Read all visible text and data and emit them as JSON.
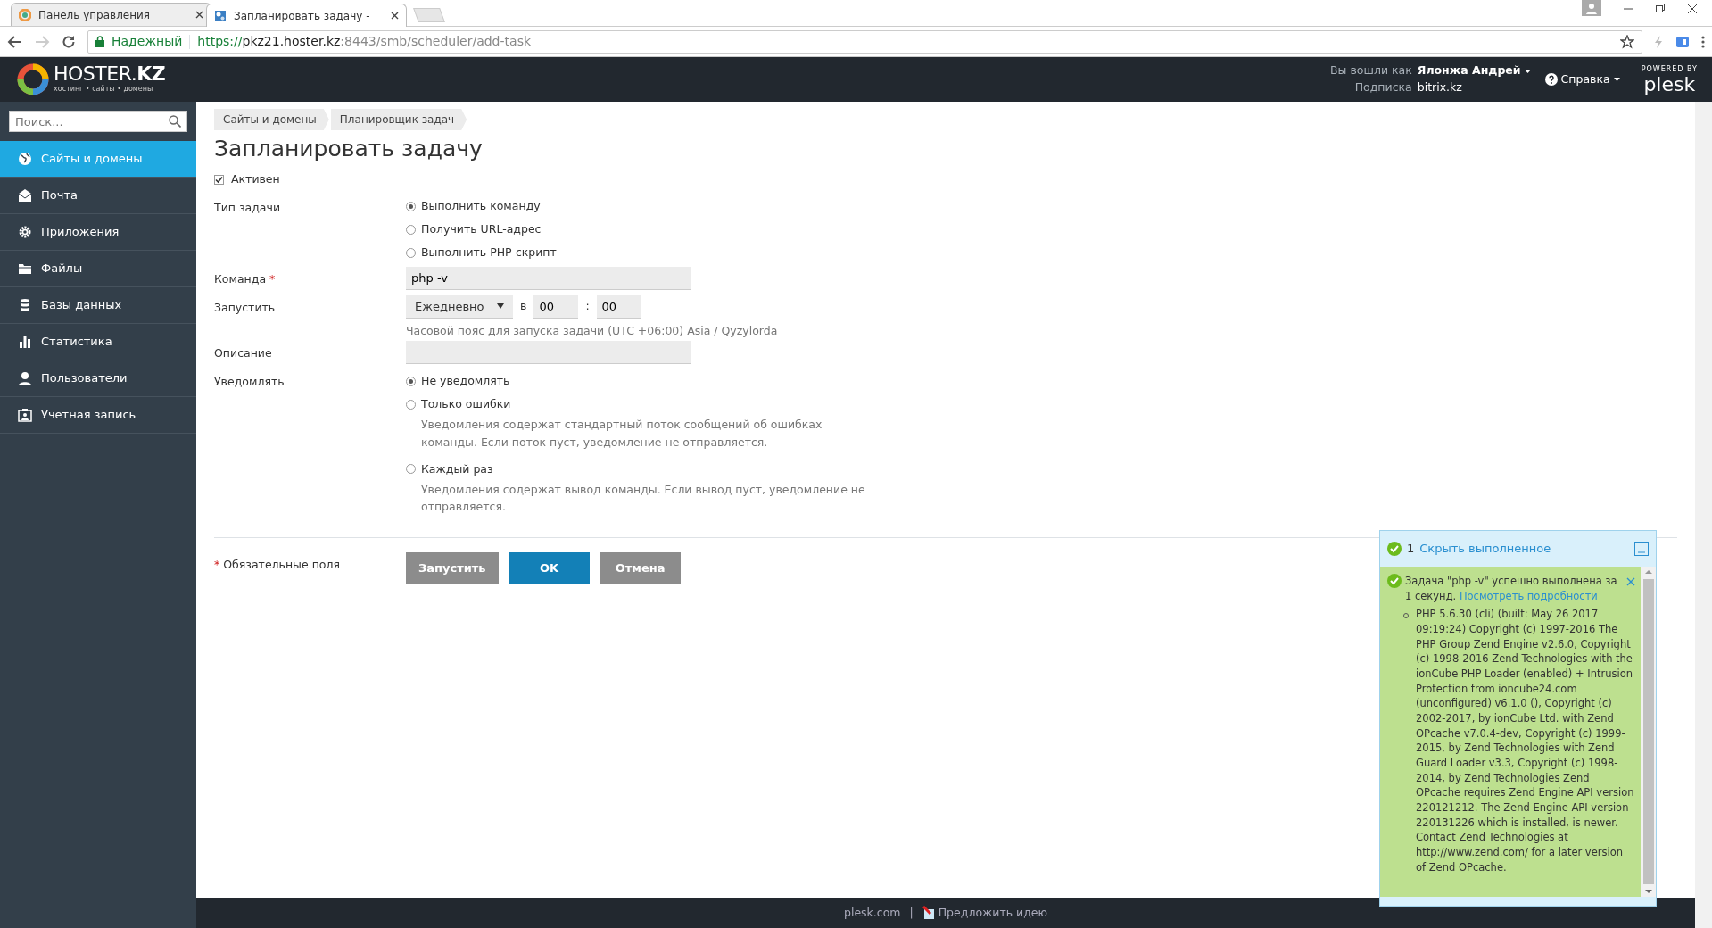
{
  "browser": {
    "tabs": [
      {
        "title": "Панель управления",
        "selected": false
      },
      {
        "title": "Запланировать задачу -",
        "selected": true
      }
    ],
    "security_label": "Надежный",
    "url_scheme": "https://",
    "url_host": "pkz21.hoster.kz",
    "url_path": ":8443/smb/scheduler/add-task"
  },
  "header": {
    "logo": "HOSTER.**KZ**",
    "tagline": "хостинг • сайты • домены",
    "user_label": "Вы вошли как",
    "user_name": "Ялонжа Андрей",
    "subscription_label": "Подписка",
    "subscription": "bitrix.kz",
    "help": "Справка",
    "powered_by": "POWERED BY",
    "brand": "plesk"
  },
  "sidebar": {
    "search": {
      "placeholder": "Поиск..."
    },
    "items": [
      {
        "label": "Сайты и домены",
        "selected": true
      },
      {
        "label": "Почта",
        "selected": false
      },
      {
        "label": "Приложения",
        "selected": false
      },
      {
        "label": "Файлы",
        "selected": false
      },
      {
        "label": "Базы данных",
        "selected": false
      },
      {
        "label": "Статистика",
        "selected": false
      },
      {
        "label": "Пользователи",
        "selected": false
      },
      {
        "label": "Учетная запись",
        "selected": false
      }
    ]
  },
  "breadcrumbs": [
    "Сайты и домены",
    "Планировщик задач"
  ],
  "title": "Запланировать задачу",
  "active": {
    "label": "Активен",
    "checked": true
  },
  "task_type": {
    "label": "Тип задачи",
    "options": [
      {
        "label": "Выполнить команду",
        "selected": true
      },
      {
        "label": "Получить URL-адрес",
        "selected": false
      },
      {
        "label": "Выполнить PHP-скрипт",
        "selected": false
      }
    ]
  },
  "command": {
    "label": "Команда",
    "required": true,
    "value": "php -v"
  },
  "run": {
    "label": "Запустить",
    "frequency": "Ежедневно",
    "at": "в",
    "hour": "00",
    "separator": ":",
    "minute": "00",
    "hint": "Часовой пояс для запуска задачи (UTC +06:00) Asia / Qyzylorda"
  },
  "description": {
    "label": "Описание"
  },
  "notify": {
    "label": "Уведомлять",
    "options": [
      {
        "label": "Не уведомлять",
        "selected": true
      },
      {
        "label": "Только ошибки",
        "selected": false,
        "hint": "Уведомления содержат стандартный поток сообщений об ошибках команды. Если поток пуст, уведомление не отправляется."
      },
      {
        "label": "Каждый раз",
        "selected": false,
        "hint": "Уведомления содержат вывод команды. Если вывод пуст, уведомление не отправляется."
      }
    ]
  },
  "required_note": {
    "mark": "*",
    "text": "Обязательные поля"
  },
  "buttons": [
    {
      "label": "Запустить",
      "kind": "secondary"
    },
    {
      "label": "OK",
      "kind": "primary"
    },
    {
      "label": "Отмена",
      "kind": "secondary"
    }
  ],
  "notification": {
    "count": "1",
    "hide_link": "Скрыть выполненное",
    "message": "Задача \"php -v\" успешно выполнена за 1 секунд.",
    "details_link": "Посмотреть подробности",
    "output": "PHP 5.6.30 (cli) (built: May 26 2017 09:19:24) Copyright (c) 1997-2016 The PHP Group Zend Engine v2.6.0, Copyright (c) 1998-2016 Zend Technologies with the ionCube PHP Loader (enabled) + Intrusion Protection from ioncube24.com (unconfigured) v6.1.0 (), Copyright (c) 2002-2017, by ionCube Ltd. with Zend OPcache v7.0.4-dev, Copyright (c) 1999-2015, by Zend Technologies with Zend Guard Loader v3.3, Copyright (c) 1998-2014, by Zend Technologies Zend OPcache requires Zend Engine API version 220121212. The Zend Engine API version 220131226 which is installed, is newer. Contact Zend Technologies at http://www.zend.com/ for a later version of Zend OPcache."
  },
  "footer": {
    "link": "plesk.com",
    "separator": "|",
    "idea": "Предложить идею"
  }
}
